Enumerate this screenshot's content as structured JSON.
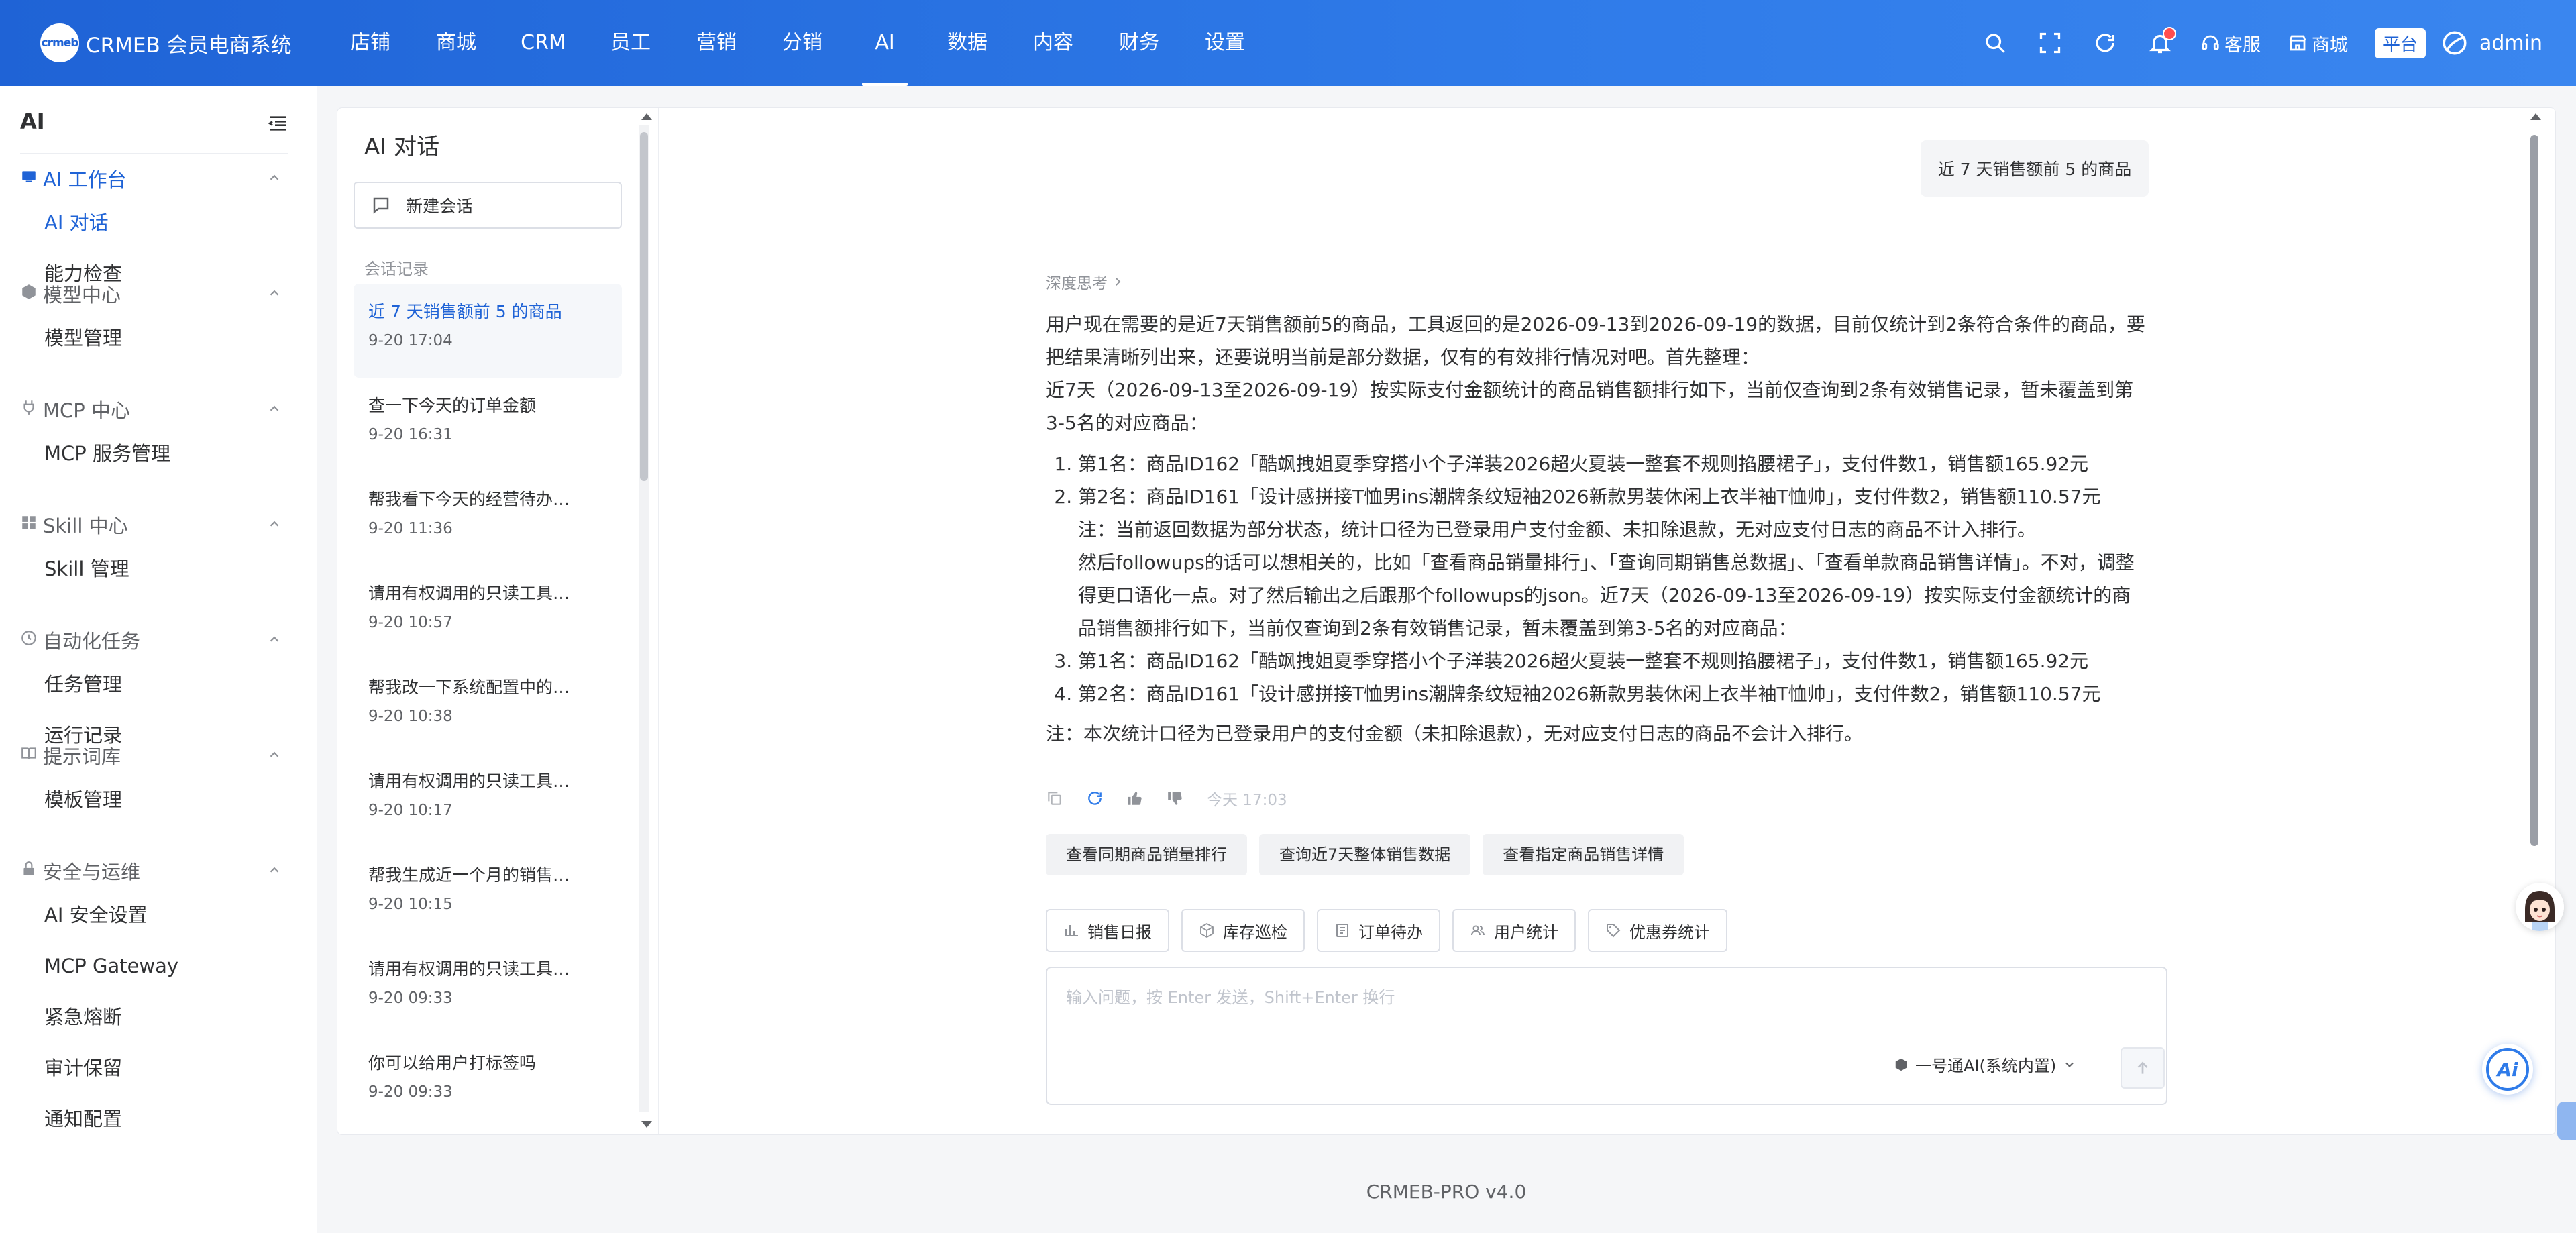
{
  "brand": {
    "logo_text": "crmeb",
    "name": "CRMEB 会员电商系统"
  },
  "topnav": [
    {
      "label": "店铺",
      "active": false
    },
    {
      "label": "商城",
      "active": false
    },
    {
      "label": "CRM",
      "active": false
    },
    {
      "label": "员工",
      "active": false
    },
    {
      "label": "营销",
      "active": false
    },
    {
      "label": "分销",
      "active": false
    },
    {
      "label": "AI",
      "active": true
    },
    {
      "label": "数据",
      "active": false
    },
    {
      "label": "内容",
      "active": false
    },
    {
      "label": "财务",
      "active": false
    },
    {
      "label": "设置",
      "active": false
    }
  ],
  "header_right": {
    "service_label": "客服",
    "mall_label": "商城",
    "platform_tag": "平台",
    "user_name": "admin",
    "has_notification": true
  },
  "sidebar": {
    "title": "AI",
    "groups": [
      {
        "label": "AI 工作台",
        "icon": "workbench-icon",
        "active": true,
        "items": [
          {
            "label": "AI 对话",
            "active": true
          },
          {
            "label": "能力检查",
            "active": false
          }
        ]
      },
      {
        "label": "模型中心",
        "icon": "cube-icon",
        "active": false,
        "items": [
          {
            "label": "模型管理",
            "active": false
          }
        ]
      },
      {
        "label": "MCP 中心",
        "icon": "plug-icon",
        "active": false,
        "items": [
          {
            "label": "MCP 服务管理",
            "active": false
          }
        ]
      },
      {
        "label": "Skill 中心",
        "icon": "grid-icon",
        "active": false,
        "items": [
          {
            "label": "Skill 管理",
            "active": false
          }
        ]
      },
      {
        "label": "自动化任务",
        "icon": "clock-icon",
        "active": false,
        "items": [
          {
            "label": "任务管理",
            "active": false
          },
          {
            "label": "运行记录",
            "active": false
          }
        ]
      },
      {
        "label": "提示词库",
        "icon": "book-icon",
        "active": false,
        "items": [
          {
            "label": "模板管理",
            "active": false
          }
        ]
      },
      {
        "label": "安全与运维",
        "icon": "lock-icon",
        "active": false,
        "items": [
          {
            "label": "AI 安全设置",
            "active": false
          },
          {
            "label": "MCP Gateway",
            "active": false
          },
          {
            "label": "紧急熔断",
            "active": false
          },
          {
            "label": "审计保留",
            "active": false
          },
          {
            "label": "通知配置",
            "active": false
          }
        ]
      }
    ]
  },
  "conversations": {
    "title": "AI 对话",
    "new_label": "新建会话",
    "history_label": "会话记录",
    "items": [
      {
        "title": "近 7 天销售额前 5 的商品",
        "time": "9-20 17:04",
        "active": true
      },
      {
        "title": "查一下今天的订单金额",
        "time": "9-20 16:31",
        "active": false
      },
      {
        "title": "帮我看下今天的经营待办，…",
        "time": "9-20 11:36",
        "active": false
      },
      {
        "title": "请用有权调用的只读工具生…",
        "time": "9-20 10:57",
        "active": false
      },
      {
        "title": "帮我改一下系统配置中的网…",
        "time": "9-20 10:38",
        "active": false
      },
      {
        "title": "请用有权调用的只读工具巡…",
        "time": "9-20 10:17",
        "active": false
      },
      {
        "title": "帮我生成近一个月的销售统…",
        "time": "9-20 10:15",
        "active": false
      },
      {
        "title": "请用有权调用的只读工具统…",
        "time": "9-20 09:33",
        "active": false
      },
      {
        "title": "你可以给用户打标签吗",
        "time": "9-20 09:33",
        "active": false
      }
    ]
  },
  "chat": {
    "user_message": "近 7 天销售额前 5 的商品",
    "deep_think_label": "深度思考",
    "answer": {
      "intro": "用户现在需要的是近7天销售额前5的商品，工具返回的是2026-09-13到2026-09-19的数据，目前仅统计到2条符合条件的商品，要把结果清晰列出来，还要说明当前是部分数据，仅有的有效排行情况对吧。首先整理：",
      "summary": "近7天（2026-09-13至2026-09-19）按实际支付金额统计的商品销售额排行如下，当前仅查询到2条有效销售记录，暂未覆盖到第3-5名的对应商品：",
      "list1": [
        "第1名：商品ID162「酷飒拽姐夏季穿搭小个子洋装2026超火夏装一整套不规则掐腰裙子」，支付件数1，销售额165.92元",
        "第2名：商品ID161「设计感拼接T恤男ins潮牌条纹短袖2026新款男装休闲上衣半袖T恤帅」，支付件数2，销售额110.57元"
      ],
      "note_line": "注：当前返回数据为部分状态，统计口径为已登录用户支付金额、未扣除退款，无对应支付日志的商品不计入排行。",
      "followup_thought": "然后followups的话可以想相关的，比如「查看商品销量排行」、「查询同期销售总数据」、「查看单款商品销售详情」。不对，调整得更口语化一点。对了然后输出之后跟那个followups的json。近7天（2026-09-13至2026-09-19）按实际支付金额统计的商品销售额排行如下，当前仅查询到2条有效销售记录，暂未覆盖到第3-5名的对应商品：",
      "list2": [
        "第1名：商品ID162「酷飒拽姐夏季穿搭小个子洋装2026超火夏装一整套不规则掐腰裙子」，支付件数1，销售额165.92元",
        "第2名：商品ID161「设计感拼接T恤男ins潮牌条纹短袖2026新款男装休闲上衣半袖T恤帅」，支付件数2，销售额110.57元"
      ],
      "final_note": "注：本次统计口径为已登录用户的支付金额（未扣除退款），无对应支付日志的商品不会计入排行。"
    },
    "message_time": "今天 17:03",
    "followups": [
      "查看同期商品销量排行",
      "查询近7天整体销售数据",
      "查看指定商品销售详情"
    ],
    "quick_actions": [
      {
        "label": "销售日报",
        "icon": "bar-chart-icon"
      },
      {
        "label": "库存巡检",
        "icon": "box-icon"
      },
      {
        "label": "订单待办",
        "icon": "list-icon"
      },
      {
        "label": "用户统计",
        "icon": "users-icon"
      },
      {
        "label": "优惠券统计",
        "icon": "tag-icon"
      }
    ],
    "input_placeholder": "输入问题，按 Enter 发送，Shift+Enter 换行",
    "model_label": "一号通AI(系统内置)"
  },
  "footer": "CRMEB-PRO v4.0",
  "colors": {
    "primary": "#1f63d6",
    "header_gradient_end": "#3a86ef",
    "notification": "#ff4d4f"
  }
}
